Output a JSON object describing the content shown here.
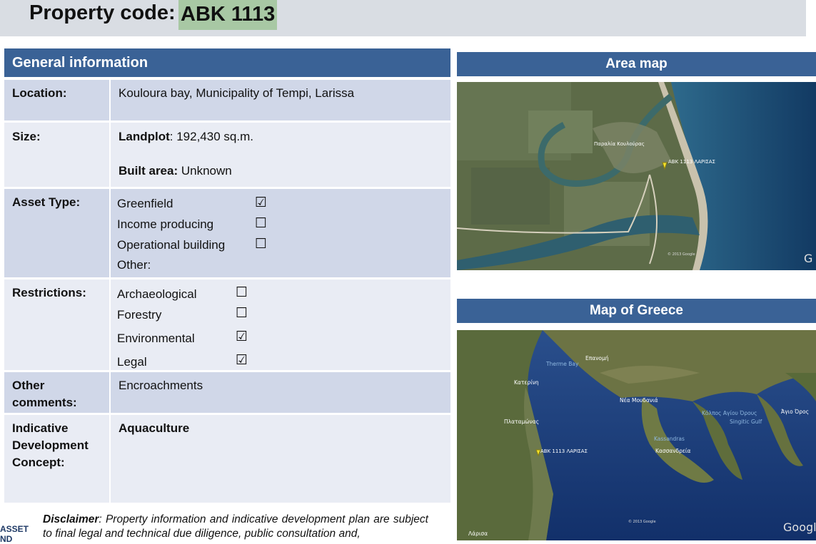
{
  "header": {
    "label": "Property code:",
    "code": "ABK 1113"
  },
  "general": {
    "title": "General information",
    "location": {
      "label": "Location:",
      "value": "Kouloura bay, Municipality of Tempi, Larissa"
    },
    "size": {
      "label": "Size:",
      "landplot_label": "Landplot",
      "landplot_value": ": 192,430 sq.m.",
      "built_label": "Built area:",
      "built_value": " Unknown"
    },
    "asset_type": {
      "label": "Asset Type:",
      "options": [
        {
          "name": "Greenfield",
          "box": "☑",
          "checked": true
        },
        {
          "name": "Income producing",
          "box": "☐",
          "checked": false
        },
        {
          "name": "Operational building",
          "box": "☐",
          "checked": false
        },
        {
          "name": "Other:",
          "box": "",
          "checked": false
        }
      ]
    },
    "restrictions": {
      "label": "Restrictions:",
      "options": [
        {
          "name": "Archaeological",
          "box": "☐",
          "checked": false
        },
        {
          "name": "Forestry",
          "box": "☐",
          "checked": false
        },
        {
          "name": "Environmental",
          "box": "☑",
          "checked": true
        },
        {
          "name": "Legal",
          "box": "☑",
          "checked": true
        }
      ]
    },
    "other": {
      "label": "Other comments:",
      "value": "Encroachments"
    },
    "concept": {
      "label": "Indicative Development Concept:",
      "value": "Aquaculture"
    }
  },
  "area_map": {
    "title": "Area map",
    "labels": {
      "place": "Παραλία Κουλούρας",
      "pin": "ABK 1113 ΛΑΡΙΣΑΣ",
      "copyright": "© 2013 Google",
      "brand": "G"
    }
  },
  "greece_map": {
    "title": "Map of Greece",
    "labels": {
      "epanomi": "Επανομή",
      "therme": "Therme Bay",
      "katerini": "Κατερίνη",
      "nea_moudania": "Νέα Μουδανιά",
      "kolpos": "Κόλπος Αγίου Όρους",
      "singitic": "Singitic Gulf",
      "agio_oros": "Άγιο Όρος",
      "plataxoro": "Πλαταμώνας",
      "kassandra": "Kassandras",
      "kassandreia": "Κασσανδρεία",
      "pin": "ABK 1113 ΛΑΡΙΣΑΣ",
      "larisa": "Λάρισα",
      "copyright": "© 2013 Google",
      "brand": "Google"
    }
  },
  "disclaimer": {
    "bold": "Disclaimer",
    "text": ": Property information and indicative development plan are subject to final legal and technical due diligence, public consultation and,"
  },
  "logo": {
    "line1": "ASSET",
    "line2": "ND"
  }
}
